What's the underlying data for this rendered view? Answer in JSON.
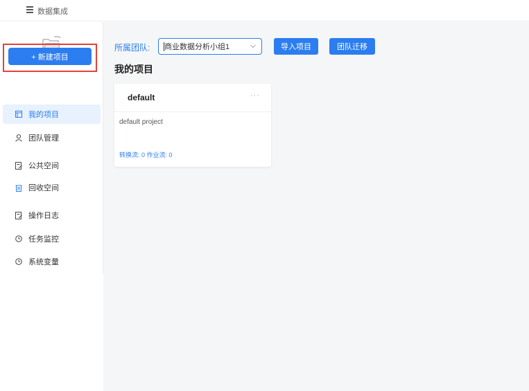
{
  "header": {
    "title": "数据集成"
  },
  "sidebar": {
    "new_button_label": "+ 新建项目",
    "items": [
      {
        "label": "我的项目",
        "icon": "project-icon"
      },
      {
        "label": "团队管理",
        "icon": "user-icon"
      },
      {
        "label": "公共空间",
        "icon": "document-icon"
      },
      {
        "label": "回收空间",
        "icon": "trash-icon"
      },
      {
        "label": "操作日志",
        "icon": "log-icon"
      },
      {
        "label": "任务监控",
        "icon": "clock-icon"
      },
      {
        "label": "系统变量",
        "icon": "clock-icon"
      }
    ]
  },
  "main": {
    "team_label": "所属团队:",
    "team_value": "商业数据分析小组1",
    "import_button": "导入项目",
    "migrate_button": "团队迁移",
    "section_title": "我的项目",
    "cards": [
      {
        "title": "default",
        "more": "···",
        "description": "default project",
        "stats": "转换流: 0   作业流: 0"
      }
    ]
  },
  "colors": {
    "accent": "#2b7df0",
    "highlight_frame": "#e2413a",
    "main_bg": "#f5f6f7"
  }
}
